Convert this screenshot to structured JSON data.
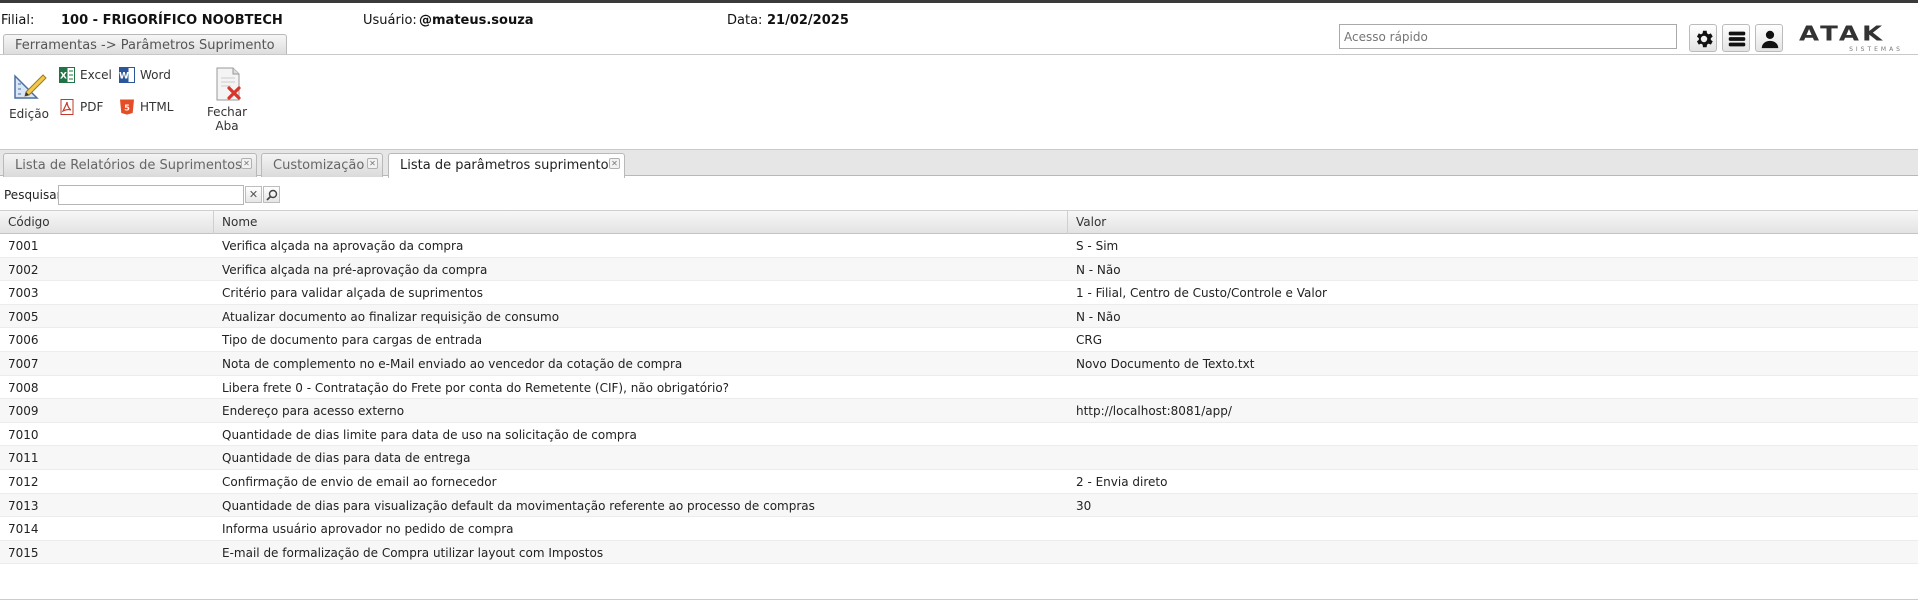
{
  "header": {
    "filial_label": "Filial:",
    "filial_value": "100 - FRIGORÍFICO NOOBTECH",
    "usuario_label": "Usuário:",
    "usuario_value": "@mateus.souza",
    "data_label": "Data:",
    "data_value": "21/02/2025",
    "breadcrumb": "Ferramentas -> Parâmetros Suprimento",
    "quick_access_placeholder": "Acesso rápido",
    "icons": [
      "gear-icon",
      "menu-icon",
      "user-icon"
    ],
    "logo": {
      "text": "ATAK",
      "subtext": "SISTEMAS"
    }
  },
  "toolbar": {
    "edicao": "Edição",
    "excel": "Excel",
    "word": "Word",
    "pdf": "PDF",
    "html": "HTML",
    "fechar_aba": "Fechar Aba"
  },
  "tabs": [
    {
      "label": "Lista de Relatórios de Suprimentos",
      "active": false
    },
    {
      "label": "Customização",
      "active": false
    },
    {
      "label": "Lista de parâmetros suprimento",
      "active": true
    }
  ],
  "search": {
    "label": "Pesquisar",
    "value": ""
  },
  "grid": {
    "headers": [
      "Código",
      "Nome",
      "Valor"
    ],
    "rows": [
      {
        "codigo": "7001",
        "nome": "Verifica alçada na aprovação da compra",
        "valor": "S - Sim"
      },
      {
        "codigo": "7002",
        "nome": "Verifica alçada na pré-aprovação da compra",
        "valor": "N - Não"
      },
      {
        "codigo": "7003",
        "nome": "Critério para validar alçada de suprimentos",
        "valor": "1 - Filial, Centro de Custo/Controle e Valor"
      },
      {
        "codigo": "7005",
        "nome": "Atualizar documento ao finalizar requisição de consumo",
        "valor": "N - Não"
      },
      {
        "codigo": "7006",
        "nome": "Tipo de documento para cargas de entrada",
        "valor": "CRG"
      },
      {
        "codigo": "7007",
        "nome": "Nota de complemento no e-Mail enviado ao vencedor da cotação de compra",
        "valor": "Novo Documento de Texto.txt"
      },
      {
        "codigo": "7008",
        "nome": "Libera frete 0 - Contratação do Frete por conta do Remetente (CIF), não obrigatório?",
        "valor": ""
      },
      {
        "codigo": "7009",
        "nome": "Endereço para acesso externo",
        "valor": "http://localhost:8081/app/"
      },
      {
        "codigo": "7010",
        "nome": "Quantidade de dias limite para data de uso na solicitação de compra",
        "valor": ""
      },
      {
        "codigo": "7011",
        "nome": "Quantidade de dias para data de entrega",
        "valor": ""
      },
      {
        "codigo": "7012",
        "nome": "Confirmação de envio de email ao fornecedor",
        "valor": "2 - Envia direto"
      },
      {
        "codigo": "7013",
        "nome": "Quantidade de dias para visualização default da movimentação referente ao processo de compras",
        "valor": "30"
      },
      {
        "codigo": "7014",
        "nome": "Informa usuário aprovador no pedido de compra",
        "valor": ""
      },
      {
        "codigo": "7015",
        "nome": "E-mail de formalização de Compra utilizar layout com Impostos",
        "valor": ""
      }
    ]
  }
}
